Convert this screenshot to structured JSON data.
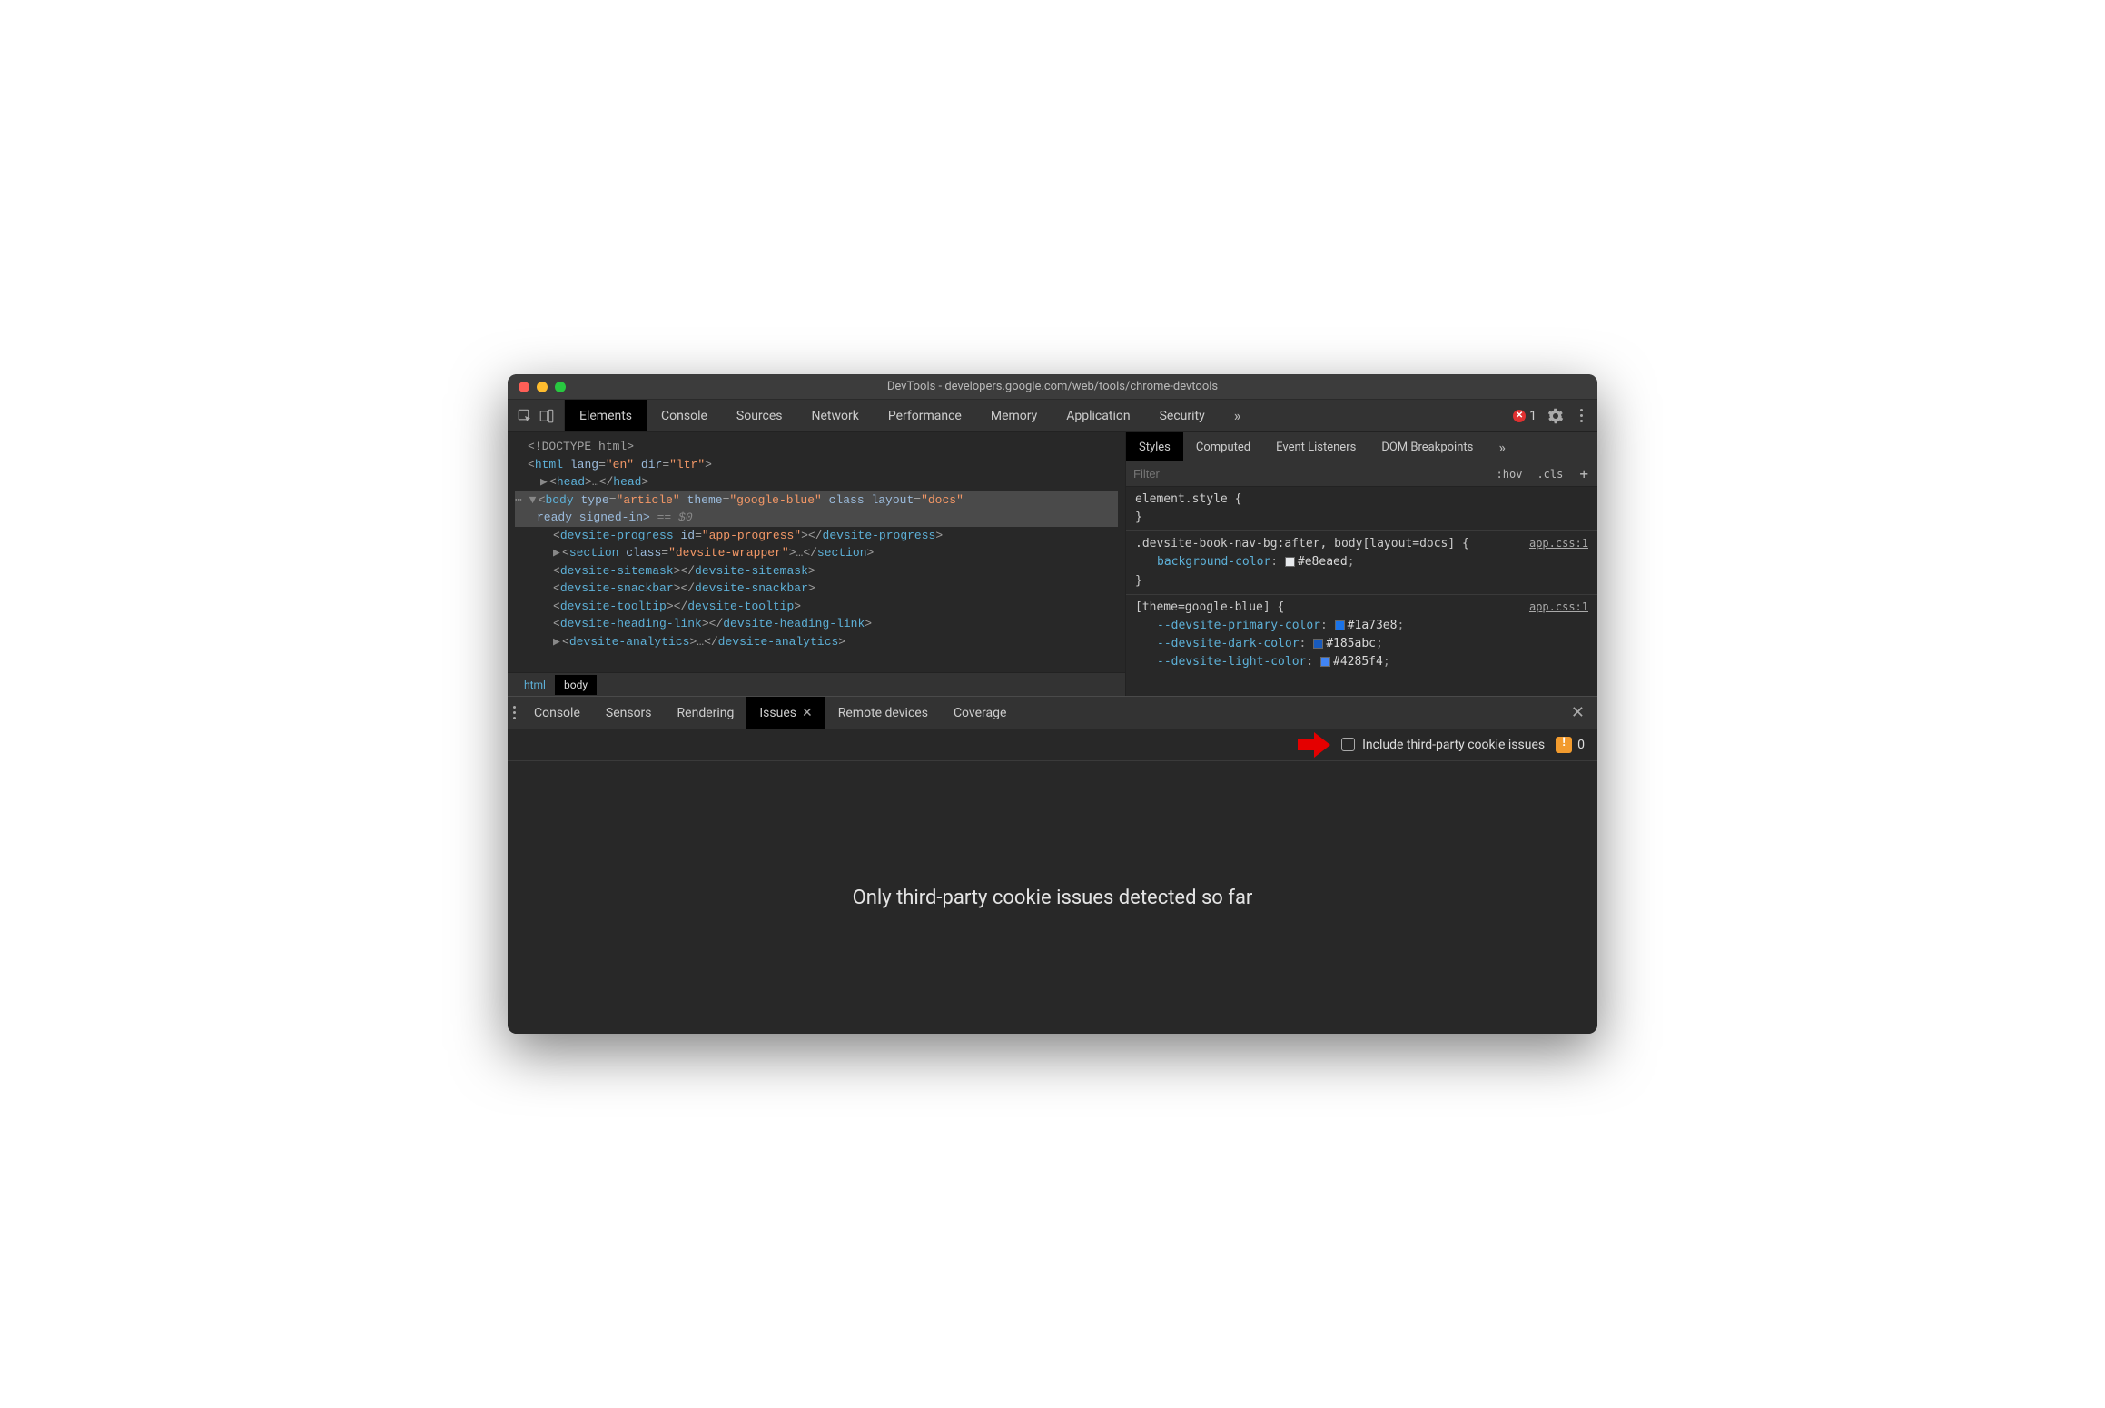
{
  "window_title": "DevTools - developers.google.com/web/tools/chrome-devtools",
  "main_tabs": [
    "Elements",
    "Console",
    "Sources",
    "Network",
    "Performance",
    "Memory",
    "Application",
    "Security"
  ],
  "main_tabs_active": "Elements",
  "main_overflow": "»",
  "error_count": "1",
  "dom": {
    "l1": "<!DOCTYPE html>",
    "l2_open": "<",
    "l2_tag": "html",
    "l2_a1n": "lang",
    "l2_a1v": "\"en\"",
    "l2_a2n": "dir",
    "l2_a2v": "\"ltr\"",
    "l2_close": ">",
    "l3_open": "<",
    "l3_tag": "head",
    "l3_mid": "…",
    "l3_end_tag": "head",
    "l4_open": "<",
    "l4_tag": "body",
    "l4_a1n": "type",
    "l4_a1v": "\"article\"",
    "l4_a2n": "theme",
    "l4_a2v": "\"google-blue\"",
    "l4_a3n": "class",
    "l4_a4n": "layout",
    "l4_a4v": "\"docs\"",
    "l5_text": "ready signed-in>",
    "l5_eq": " == $0",
    "l6_open": "<",
    "l6_tag": "devsite-progress",
    "l6_a1n": "id",
    "l6_a1v": "\"app-progress\"",
    "l6_close": ">",
    "l6_end_tag": "devsite-progress",
    "l7_open": "<",
    "l7_tag": "section",
    "l7_a1n": "class",
    "l7_a1v": "\"devsite-wrapper\"",
    "l7_mid": "…",
    "l7_end_tag": "section",
    "l8_tag": "devsite-sitemask",
    "l9_tag": "devsite-snackbar",
    "l10_tag": "devsite-tooltip",
    "l11_tag": "devsite-heading-link",
    "l12_tag": "devsite-analytics",
    "l12_mid": "…"
  },
  "breadcrumbs": [
    "html",
    "body"
  ],
  "breadcrumb_active": "body",
  "styles_tabs": [
    "Styles",
    "Computed",
    "Event Listeners",
    "DOM Breakpoints"
  ],
  "styles_tabs_active": "Styles",
  "styles_overflow": "»",
  "filter_placeholder": "Filter",
  "hov": ":hov",
  "cls": ".cls",
  "rule1_sel": "element.style {",
  "rule1_close": "}",
  "rule2_sel": ".devsite-book-nav-bg:after, body[layout=docs] {",
  "rule2_link": "app.css:1",
  "rule2_prop_name": "background-color",
  "rule2_prop_val": "#e8eaed",
  "rule2_close": "}",
  "rule3_sel": "[theme=google-blue] {",
  "rule3_link": "app.css:1",
  "rule3_p1_name": "--devsite-primary-color",
  "rule3_p1_val": "#1a73e8",
  "rule3_p2_name": "--devsite-dark-color",
  "rule3_p2_val": "#185abc",
  "rule3_p3_name": "--devsite-light-color",
  "rule3_p3_val": "#4285f4",
  "drawer_tabs": [
    "Console",
    "Sensors",
    "Rendering",
    "Issues",
    "Remote devices",
    "Coverage"
  ],
  "drawer_active": "Issues",
  "checkbox_label": "Include third-party cookie issues",
  "warning_count": "0",
  "issues_message": "Only third-party cookie issues detected so far"
}
